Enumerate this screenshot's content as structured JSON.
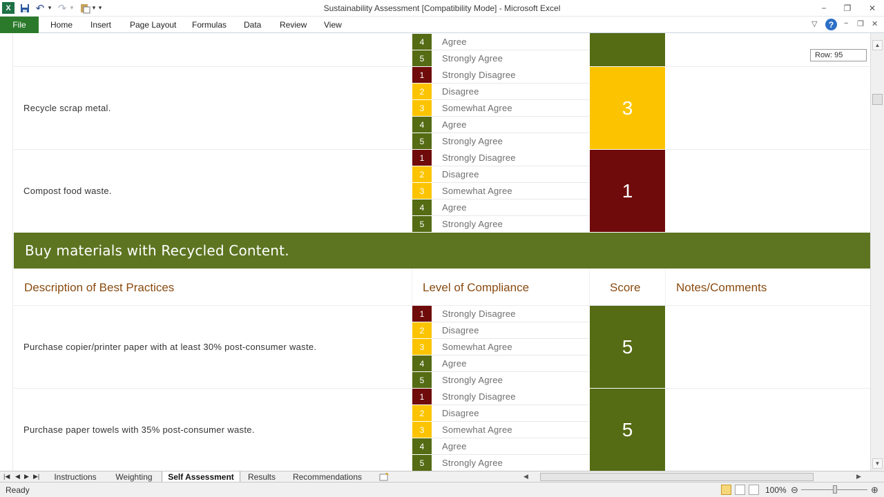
{
  "window": {
    "title": "Sustainability Assessment  [Compatibility Mode]  -  Microsoft Excel",
    "minimize": "−",
    "restore": "❐",
    "close": "✕"
  },
  "qat": {
    "excel": "X",
    "save": "💾",
    "undo": "↶",
    "redo": "↷",
    "paste": "📋",
    "customize": "▾"
  },
  "ribbon": {
    "tabs": [
      "File",
      "Home",
      "Insert",
      "Page Layout",
      "Formulas",
      "Data",
      "Review",
      "View"
    ],
    "help": "?",
    "minimize_ribbon": "▽"
  },
  "tooltip": "Row: 95",
  "options": [
    "Strongly Disagree",
    "Disagree",
    "Somewhat Agree",
    "Agree",
    "Strongly Agree"
  ],
  "option_numbers": [
    "1",
    "2",
    "3",
    "4",
    "5"
  ],
  "partial_item": {
    "options": [
      "Agree",
      "Strongly Agree"
    ],
    "numbers": [
      "4",
      "5"
    ]
  },
  "items_top": [
    {
      "text": "Recycle scrap metal.",
      "score": "3"
    },
    {
      "text": "Compost food waste.",
      "score": "1"
    }
  ],
  "section": {
    "title": "Buy materials with Recycled Content.",
    "headers": [
      "Description of Best Practices",
      "Level of Compliance",
      "Score",
      "Notes/Comments"
    ]
  },
  "items_bottom": [
    {
      "text": "Purchase copier/printer paper with at least 30% post-consumer waste.",
      "score": "5"
    },
    {
      "text": "Purchase paper towels with 35% post-consumer waste.",
      "score": "5"
    }
  ],
  "colors": {
    "disagree_dark": "#6f0b0b",
    "yellow": "#fcc400",
    "green": "#556b14",
    "section": "#5d7521",
    "header_text": "#8a4b10"
  },
  "sheet_tabs": [
    "Instructions",
    "Weighting",
    "Self Assessment",
    "Results",
    "Recommendations"
  ],
  "active_sheet": "Self Assessment",
  "status": {
    "ready": "Ready",
    "zoom": "100%"
  }
}
